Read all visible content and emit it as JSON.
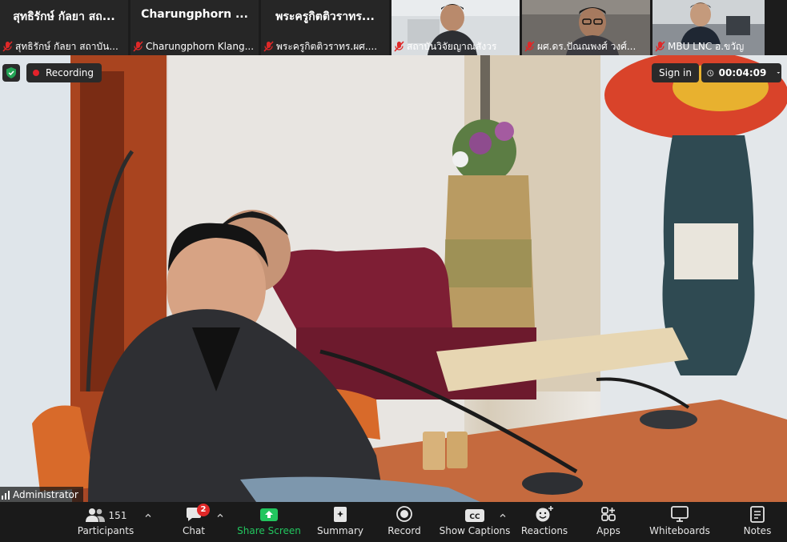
{
  "strip": {
    "tiles": [
      {
        "title": "สุทธิรักษ์ กัลยา สถ...",
        "label": "สุทธิรักษ์ กัลยา สถาบัน..."
      },
      {
        "title": "Charungphorn ...",
        "label": "Charungphorn Klang..."
      },
      {
        "title": "พระครูกิตติวราทร...",
        "label": "พระครูกิตติวราทร.ผศ...."
      },
      {
        "title": "",
        "label": "สถาบันวิจัยญาณสังวร"
      },
      {
        "title": "",
        "label": "ผศ.ดร.ปัณณพงศ์ วงศ์..."
      },
      {
        "title": "",
        "label": "MBU LNC อ.ขวัญ"
      }
    ]
  },
  "overlay": {
    "recording_label": "Recording",
    "sign_in_label": "Sign in",
    "timer": "00:04:09",
    "active_speaker": "Administrator"
  },
  "toolbar": {
    "participants_label": "Participants",
    "participants_count": "151",
    "chat_label": "Chat",
    "chat_badge": "2",
    "share_label": "Share Screen",
    "summary_label": "Summary",
    "record_label": "Record",
    "captions_label": "Show Captions",
    "reactions_label": "Reactions",
    "apps_label": "Apps",
    "whiteboards_label": "Whiteboards",
    "notes_label": "Notes"
  },
  "colors": {
    "toolbar_bg": "#1a1a1a",
    "share_green": "#22c55e",
    "recording_red": "#e4222b",
    "mic_off_red": "#e02828",
    "secure_green": "#23a455"
  }
}
